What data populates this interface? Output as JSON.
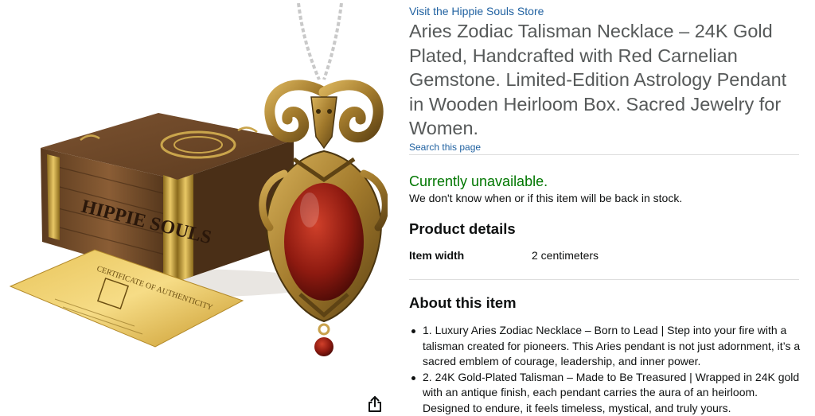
{
  "product_image": {
    "box_brand_text": "HIPPIE SOULS",
    "certificate_title": "CERTIFICATE OF AUTHENTICITY"
  },
  "share": {
    "icon": "share-icon"
  },
  "store": {
    "link_text": "Visit the Hippie Souls Store"
  },
  "product": {
    "title": "Aries Zodiac Talisman Necklace – 24K Gold Plated, Handcrafted with Red Carnelian Gemstone. Limited-Edition Astrology Pendant in Wooden Heirloom Box. Sacred Jewelry for Women."
  },
  "search_page": {
    "link_text": "Search this page"
  },
  "availability": {
    "status": "Currently unavailable.",
    "note": "We don't know when or if this item will be back in stock.",
    "color": "#007600"
  },
  "product_details": {
    "heading": "Product details",
    "rows": [
      {
        "key": "Item width",
        "value": "2 centimeters"
      }
    ]
  },
  "about": {
    "heading": "About this item",
    "bullets": [
      "1. Luxury Aries Zodiac Necklace – Born to Lead | Step into your fire with a talisman created for pioneers. This Aries pendant is not just adornment, it’s a sacred emblem of courage, leadership, and inner power.",
      "2. 24K Gold-Plated Talisman – Made to Be Treasured | Wrapped in 24K gold with an antique finish, each pendant carries the aura of an heirloom. Designed to endure, it feels timeless, mystical, and truly yours."
    ]
  },
  "colors": {
    "link": "#2162a1",
    "title": "#565959",
    "text": "#0f1111",
    "divider": "#dddddd"
  }
}
